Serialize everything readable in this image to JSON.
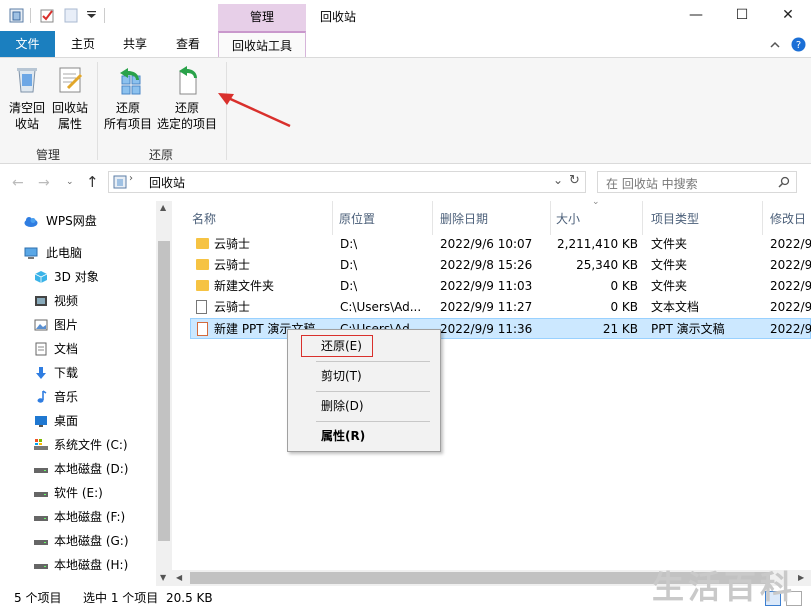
{
  "window": {
    "title": "回收站",
    "context_tab": "管理",
    "minimize": "—",
    "maximize": "☐",
    "close": "✕"
  },
  "tabs": [
    "文件",
    "主页",
    "共享",
    "查看",
    "回收站工具"
  ],
  "ribbon": {
    "empty_bin": [
      "清空回",
      "收站"
    ],
    "bin_props": [
      "回收站",
      "属性"
    ],
    "restore_all": [
      "还原",
      "所有项目"
    ],
    "restore_selected": [
      "还原",
      "选定的项目"
    ],
    "group_manage": "管理",
    "group_restore": "还原"
  },
  "address": {
    "path": "回收站",
    "search_placeholder": "在 回收站 中搜索"
  },
  "nav": {
    "wps": "WPS网盘",
    "pc": "此电脑",
    "items": [
      "3D 对象",
      "视频",
      "图片",
      "文档",
      "下载",
      "音乐",
      "桌面",
      "系统文件 (C:)",
      "本地磁盘 (D:)",
      "软件 (E:)",
      "本地磁盘 (F:)",
      "本地磁盘 (G:)",
      "本地磁盘 (H:)"
    ]
  },
  "columns": [
    "名称",
    "原位置",
    "删除日期",
    "大小",
    "项目类型",
    "修改日"
  ],
  "files": [
    {
      "name": "云骑士",
      "loc": "D:\\",
      "deleted": "2022/9/6 10:07",
      "size": "2,211,410 KB",
      "type": "文件夹",
      "mod": "2022/9"
    },
    {
      "name": "云骑士",
      "loc": "D:\\",
      "deleted": "2022/9/8 15:26",
      "size": "25,340 KB",
      "type": "文件夹",
      "mod": "2022/9"
    },
    {
      "name": "新建文件夹",
      "loc": "D:\\",
      "deleted": "2022/9/9 11:03",
      "size": "0 KB",
      "type": "文件夹",
      "mod": "2022/9"
    },
    {
      "name": "云骑士",
      "loc": "C:\\Users\\Ad...",
      "deleted": "2022/9/9 11:27",
      "size": "0 KB",
      "type": "文本文档",
      "mod": "2022/9"
    },
    {
      "name": "新建 PPT 演示文稿",
      "loc": "C:\\Users\\Ad...",
      "deleted": "2022/9/9 11:36",
      "size": "21 KB",
      "type": "PPT 演示文稿",
      "mod": "2022/9"
    }
  ],
  "context_menu": {
    "restore": "还原(E)",
    "cut": "剪切(T)",
    "delete": "删除(D)",
    "properties": "属性(R)"
  },
  "status": {
    "count": "5 个项目",
    "selected": "选中 1 个项目",
    "size": "20.5 KB"
  },
  "watermark": "生活百科",
  "colors": {
    "file_tab": "#1b7fbf",
    "context_tab": "#e7cfe8",
    "selection": "#cce8ff",
    "arrow": "#d9302c"
  }
}
